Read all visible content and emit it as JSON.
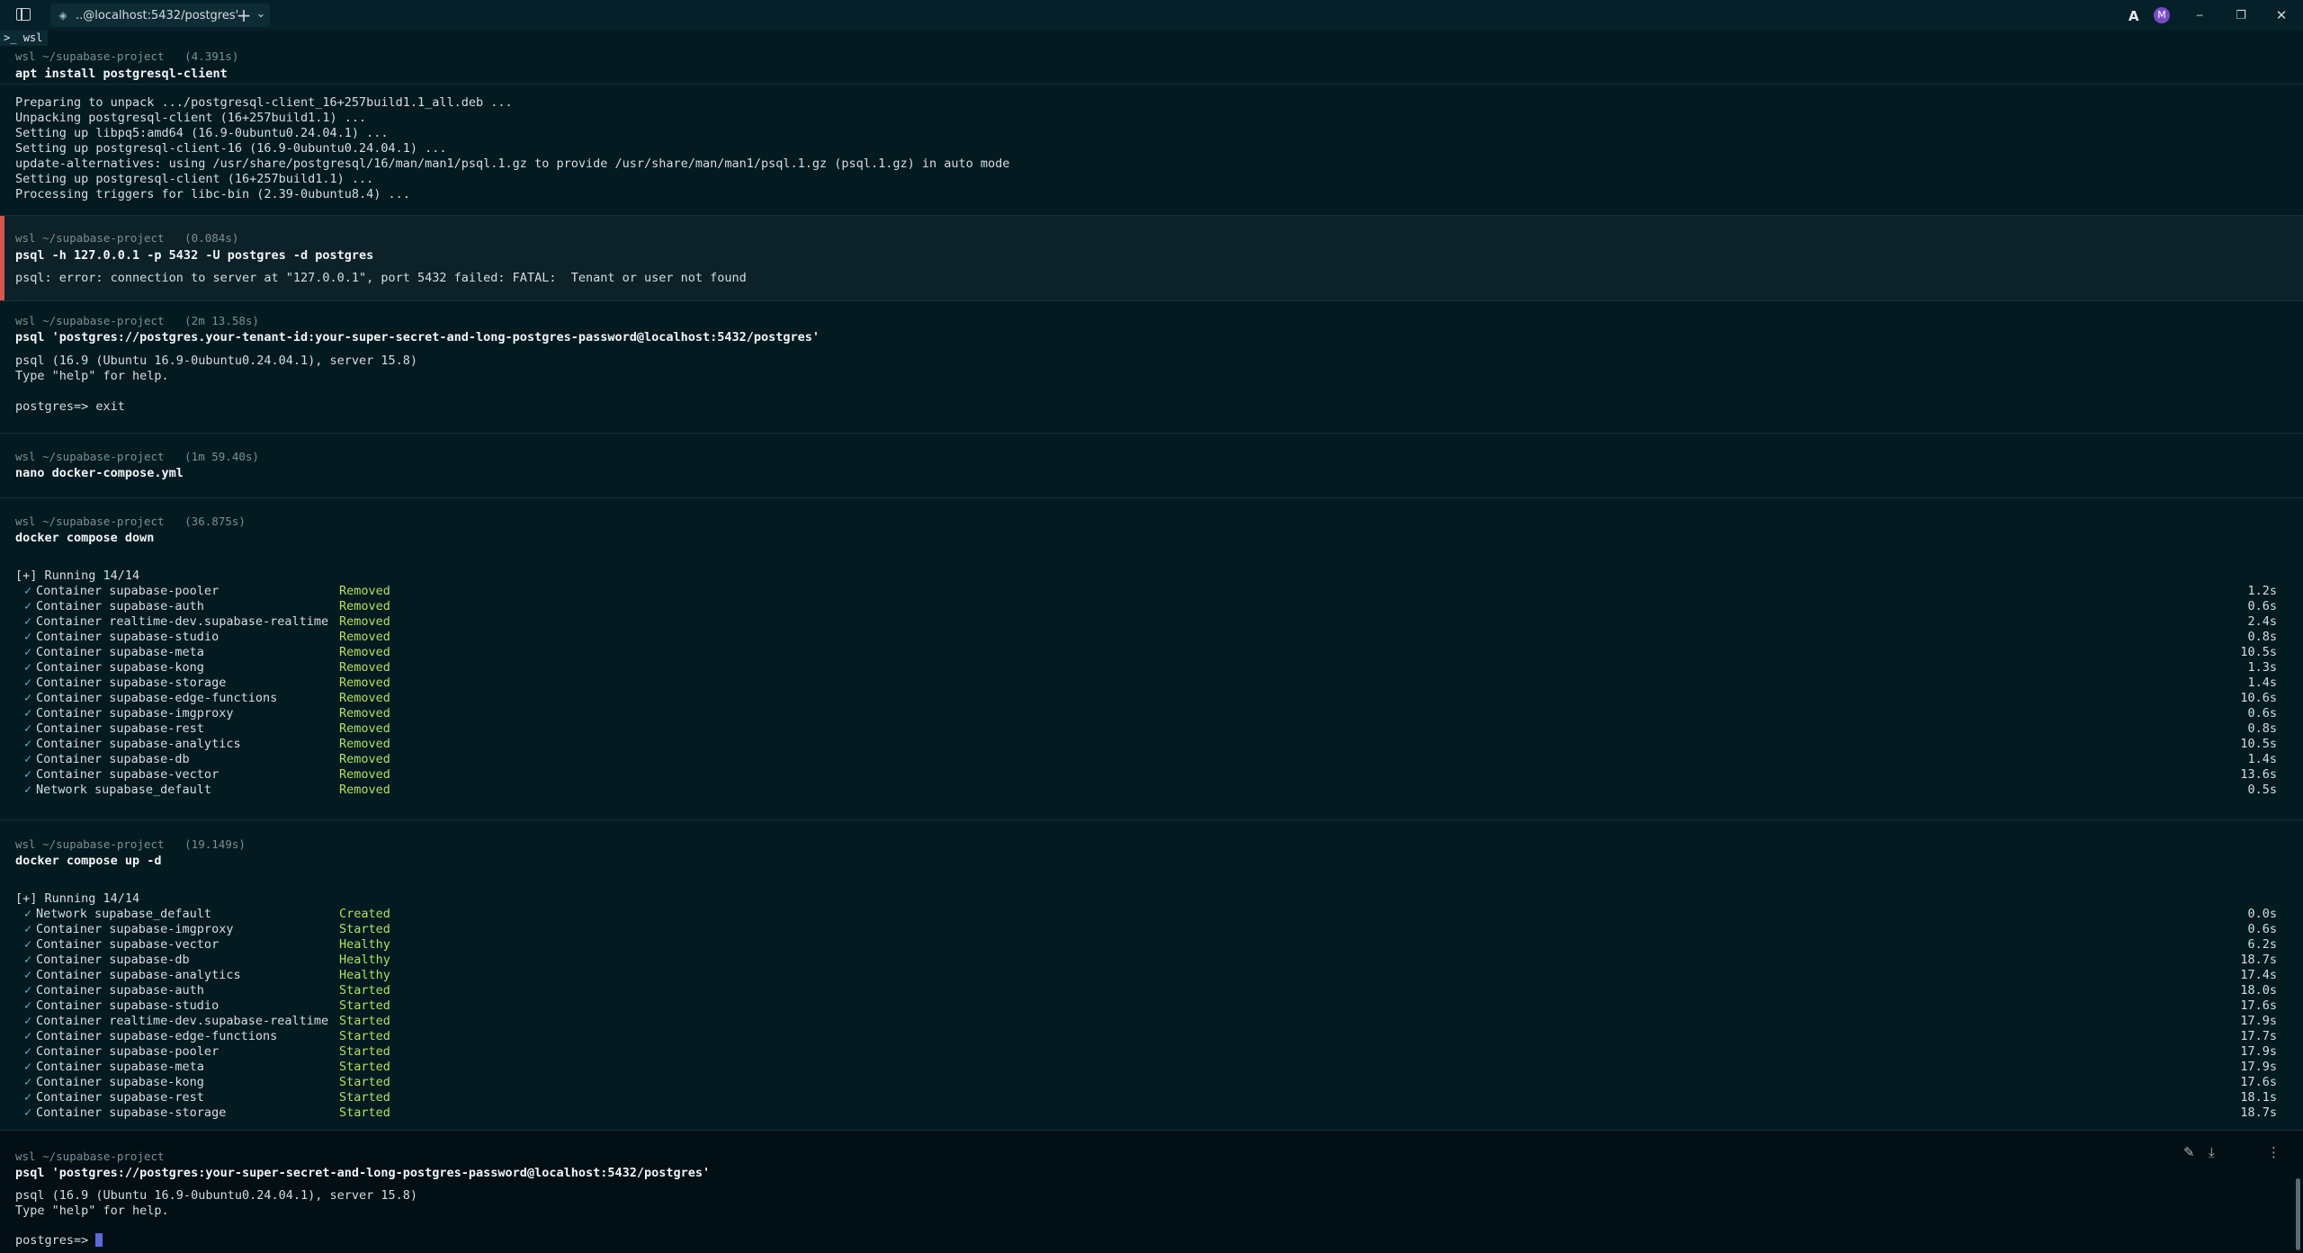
{
  "window": {
    "tab_title": "..@localhost:5432/postgres'",
    "tab_icon": "terminal-tab-icon",
    "new_tab": "+",
    "dropdown": "⌄",
    "minimize": "─",
    "maximize": "❐",
    "close": "✕",
    "profile_text": "wsl",
    "user_initial": "M"
  },
  "blocks": {
    "b1": {
      "header": "wsl ~/supabase-project   (4.391s)",
      "command": "apt install postgresql-client",
      "output": [
        "Preparing to unpack .../postgresql-client_16+257build1.1_all.deb ...",
        "Unpacking postgresql-client (16+257build1.1) ...",
        "Setting up libpq5:amd64 (16.9-0ubuntu0.24.04.1) ...",
        "Setting up postgresql-client-16 (16.9-0ubuntu0.24.04.1) ...",
        "update-alternatives: using /usr/share/postgresql/16/man/man1/psql.1.gz to provide /usr/share/man/man1/psql.1.gz (psql.1.gz) in auto mode",
        "Setting up postgresql-client (16+257build1.1) ...",
        "Processing triggers for libc-bin (2.39-0ubuntu8.4) ..."
      ]
    },
    "b2": {
      "header": "wsl ~/supabase-project   (0.084s)",
      "command": "psql -h 127.0.0.1 -p 5432 -U postgres -d postgres",
      "output": [
        "psql: error: connection to server at \"127.0.0.1\", port 5432 failed: FATAL:  Tenant or user not found"
      ]
    },
    "b3": {
      "header": "wsl ~/supabase-project   (2m 13.58s)",
      "command": "psql 'postgres://postgres.your-tenant-id:your-super-secret-and-long-postgres-password@localhost:5432/postgres'",
      "output": [
        "psql (16.9 (Ubuntu 16.9-0ubuntu0.24.04.1), server 15.8)",
        "Type \"help\" for help.",
        "",
        "postgres=> exit"
      ]
    },
    "b4": {
      "header": "wsl ~/supabase-project   (1m 59.40s)",
      "command": "nano docker-compose.yml"
    },
    "b5": {
      "header": "wsl ~/supabase-project   (36.875s)",
      "command": "docker compose down",
      "running": "[+] Running 14/14",
      "rows": [
        {
          "name": "Container supabase-pooler",
          "status": "Removed",
          "time": "1.2s"
        },
        {
          "name": "Container supabase-auth",
          "status": "Removed",
          "time": "0.6s"
        },
        {
          "name": "Container realtime-dev.supabase-realtime",
          "status": "Removed",
          "time": "2.4s"
        },
        {
          "name": "Container supabase-studio",
          "status": "Removed",
          "time": "0.8s"
        },
        {
          "name": "Container supabase-meta",
          "status": "Removed",
          "time": "10.5s"
        },
        {
          "name": "Container supabase-kong",
          "status": "Removed",
          "time": "1.3s"
        },
        {
          "name": "Container supabase-storage",
          "status": "Removed",
          "time": "1.4s"
        },
        {
          "name": "Container supabase-edge-functions",
          "status": "Removed",
          "time": "10.6s"
        },
        {
          "name": "Container supabase-imgproxy",
          "status": "Removed",
          "time": "0.6s"
        },
        {
          "name": "Container supabase-rest",
          "status": "Removed",
          "time": "0.8s"
        },
        {
          "name": "Container supabase-analytics",
          "status": "Removed",
          "time": "10.5s"
        },
        {
          "name": "Container supabase-db",
          "status": "Removed",
          "time": "1.4s"
        },
        {
          "name": "Container supabase-vector",
          "status": "Removed",
          "time": "13.6s"
        },
        {
          "name": "Network supabase_default",
          "status": "Removed",
          "time": "0.5s"
        }
      ]
    },
    "b6": {
      "header": "wsl ~/supabase-project   (19.149s)",
      "command": "docker compose up -d",
      "running": "[+] Running 14/14",
      "rows": [
        {
          "name": "Network supabase_default",
          "status": "Created",
          "time": "0.0s"
        },
        {
          "name": "Container supabase-imgproxy",
          "status": "Started",
          "time": "0.6s"
        },
        {
          "name": "Container supabase-vector",
          "status": "Healthy",
          "time": "6.2s"
        },
        {
          "name": "Container supabase-db",
          "status": "Healthy",
          "time": "18.7s"
        },
        {
          "name": "Container supabase-analytics",
          "status": "Healthy",
          "time": "17.4s"
        },
        {
          "name": "Container supabase-auth",
          "status": "Started",
          "time": "18.0s"
        },
        {
          "name": "Container supabase-studio",
          "status": "Started",
          "time": "17.6s"
        },
        {
          "name": "Container realtime-dev.supabase-realtime",
          "status": "Started",
          "time": "17.9s"
        },
        {
          "name": "Container supabase-edge-functions",
          "status": "Started",
          "time": "17.7s"
        },
        {
          "name": "Container supabase-pooler",
          "status": "Started",
          "time": "17.9s"
        },
        {
          "name": "Container supabase-meta",
          "status": "Started",
          "time": "17.9s"
        },
        {
          "name": "Container supabase-kong",
          "status": "Started",
          "time": "17.6s"
        },
        {
          "name": "Container supabase-rest",
          "status": "Started",
          "time": "18.1s"
        },
        {
          "name": "Container supabase-storage",
          "status": "Started",
          "time": "18.7s"
        }
      ]
    },
    "b7": {
      "header": "wsl ~/supabase-project",
      "command": "psql 'postgres://postgres:your-super-secret-and-long-postgres-password@localhost:5432/postgres'",
      "output": [
        "psql (16.9 (Ubuntu 16.9-0ubuntu0.24.04.1), server 15.8)",
        "Type \"help\" for help."
      ],
      "prompt": "postgres=> "
    }
  },
  "colors": {
    "background": "#041a21",
    "status_green": "#b7df5d",
    "check_blue": "#5db3d6",
    "error_bar": "#d4574f",
    "cursor": "#5b6ad8"
  }
}
